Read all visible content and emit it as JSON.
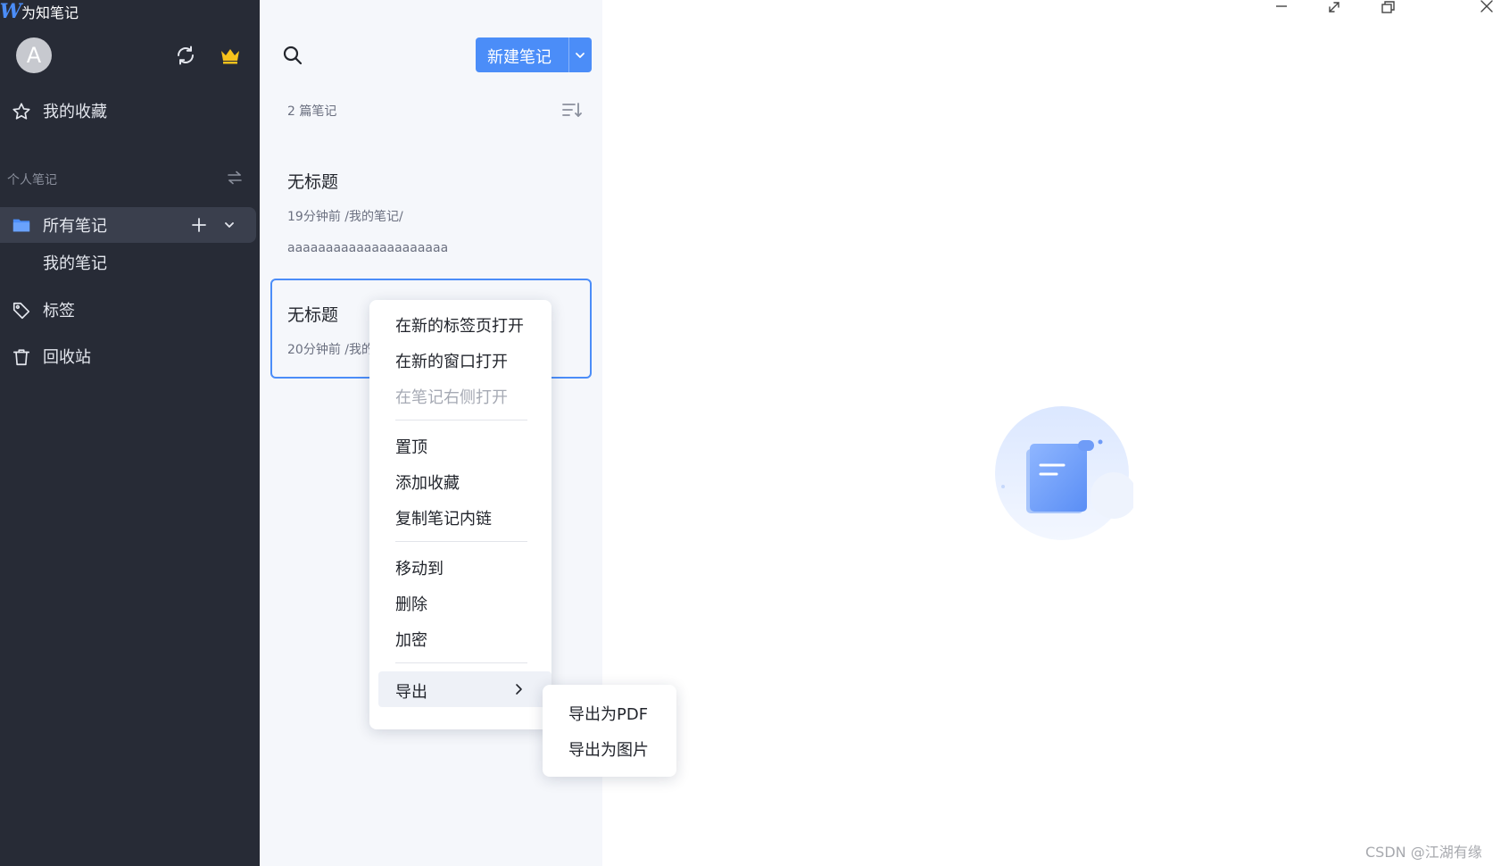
{
  "app": {
    "title": "为知笔记",
    "logo": "W"
  },
  "sidebar": {
    "avatar_letter": "A",
    "favorites_label": "我的收藏",
    "section_title": "个人笔记",
    "all_notes_label": "所有笔记",
    "sub_folder_label": "我的笔记",
    "tags_label": "标签",
    "trash_label": "回收站"
  },
  "notelist": {
    "new_note_label": "新建笔记",
    "count_label": "2 篇笔记",
    "notes": [
      {
        "title": "无标题",
        "meta": "19分钟前  /我的笔记/",
        "preview": "aaaaaaaaaaaaaaaaaaaaa"
      },
      {
        "title": "无标题",
        "meta": "20分钟前  /我的笔记/"
      }
    ]
  },
  "context_menu": {
    "items": [
      "在新的标签页打开",
      "在新的窗口打开",
      "在笔记右侧打开",
      "置顶",
      "添加收藏",
      "复制笔记内链",
      "移动到",
      "删除",
      "加密",
      "导出"
    ],
    "export_submenu": [
      "导出为PDF",
      "导出为图片"
    ]
  },
  "watermark": "CSDN @江湖有缘",
  "colors": {
    "accent": "#4b8df8",
    "sidebar_bg": "#272b36",
    "list_bg": "#f5f7fb",
    "vip": "#f6c21c"
  }
}
